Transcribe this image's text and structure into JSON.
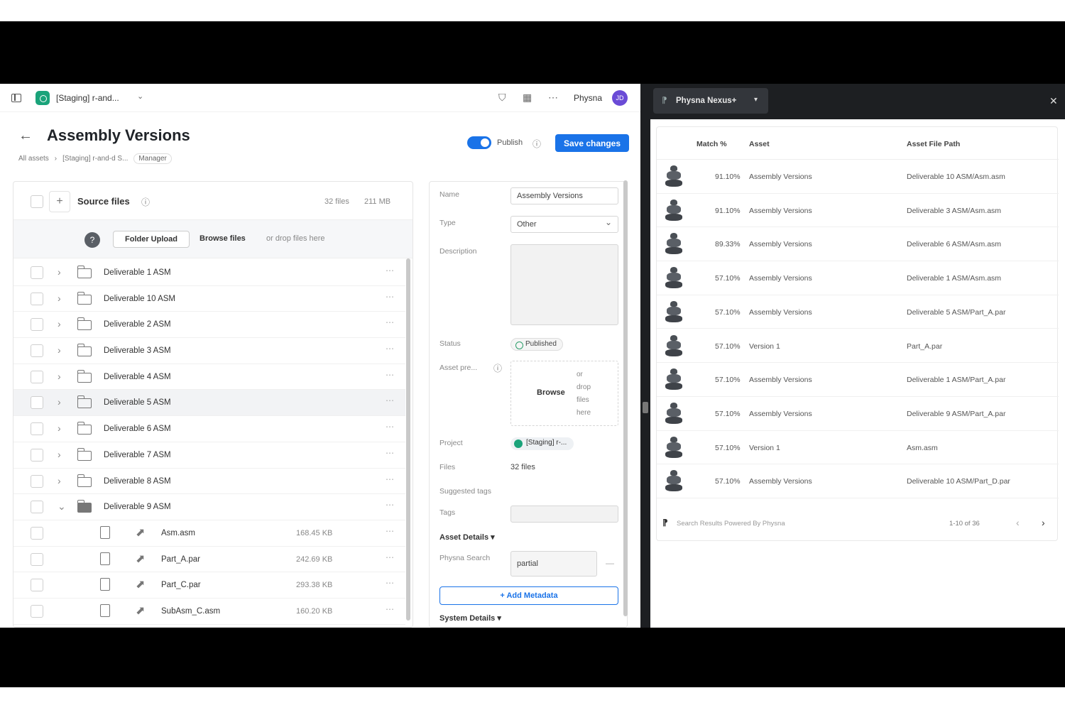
{
  "topbar": {
    "project_name": "[Staging] r-and...",
    "user_name": "Physna",
    "avatar_initials": "JD"
  },
  "page": {
    "title": "Assembly Versions",
    "breadcrumb": [
      "All assets",
      "[Staging] r-and-d S...",
      "Manager"
    ],
    "publish_label": "Publish",
    "save_label": "Save changes"
  },
  "source_files": {
    "label": "Source files",
    "count": "32 files",
    "size": "211 MB",
    "folder_upload": "Folder Upload",
    "browse_files": "Browse files",
    "drop_text": "or drop files here",
    "folders": [
      {
        "name": "Deliverable 1 ASM"
      },
      {
        "name": "Deliverable 10 ASM"
      },
      {
        "name": "Deliverable 2 ASM"
      },
      {
        "name": "Deliverable 3 ASM"
      },
      {
        "name": "Deliverable 4 ASM"
      },
      {
        "name": "Deliverable 5 ASM"
      },
      {
        "name": "Deliverable 6 ASM"
      },
      {
        "name": "Deliverable 7 ASM"
      },
      {
        "name": "Deliverable 8 ASM"
      },
      {
        "name": "Deliverable 9 ASM"
      }
    ],
    "files": [
      {
        "name": "Asm.asm",
        "size": "168.45 KB"
      },
      {
        "name": "Part_A.par",
        "size": "242.69 KB"
      },
      {
        "name": "Part_C.par",
        "size": "293.38 KB"
      },
      {
        "name": "SubAsm_C.asm",
        "size": "160.20 KB"
      }
    ]
  },
  "details": {
    "name_label": "Name",
    "name_value": "Assembly Versions",
    "type_label": "Type",
    "type_value": "Other",
    "description_label": "Description",
    "status_label": "Status",
    "status_value": "Published",
    "preview_label": "Asset pre...",
    "preview_browse": "Browse",
    "preview_drop": "or drop files here",
    "project_label": "Project",
    "project_value": "[Staging] r-...",
    "files_label": "Files",
    "files_value": "32 files",
    "suggested_tags_label": "Suggested tags",
    "tags_label": "Tags",
    "asset_details": "Asset Details",
    "physna_search_label": "Physna Search",
    "physna_search_value": "partial",
    "add_metadata": "+ Add Metadata",
    "system_details": "System Details"
  },
  "extension": {
    "tab_label": "Physna Nexus+",
    "columns": {
      "match": "Match %",
      "asset": "Asset",
      "path": "Asset File Path"
    },
    "results": [
      {
        "match": "91.10%",
        "asset": "Assembly Versions",
        "path": "Deliverable 10 ASM/Asm.asm"
      },
      {
        "match": "91.10%",
        "asset": "Assembly Versions",
        "path": "Deliverable 3 ASM/Asm.asm"
      },
      {
        "match": "89.33%",
        "asset": "Assembly Versions",
        "path": "Deliverable 6 ASM/Asm.asm"
      },
      {
        "match": "57.10%",
        "asset": "Assembly Versions",
        "path": "Deliverable 1 ASM/Asm.asm"
      },
      {
        "match": "57.10%",
        "asset": "Assembly Versions",
        "path": "Deliverable 5 ASM/Part_A.par"
      },
      {
        "match": "57.10%",
        "asset": "Version 1",
        "path": "Part_A.par"
      },
      {
        "match": "57.10%",
        "asset": "Assembly Versions",
        "path": "Deliverable 1 ASM/Part_A.par"
      },
      {
        "match": "57.10%",
        "asset": "Assembly Versions",
        "path": "Deliverable 9 ASM/Part_A.par"
      },
      {
        "match": "57.10%",
        "asset": "Version 1",
        "path": "Asm.asm"
      },
      {
        "match": "57.10%",
        "asset": "Assembly Versions",
        "path": "Deliverable 10 ASM/Part_D.par"
      }
    ],
    "footer": "Search Results Powered By Physna",
    "pager": "1-10 of 36"
  }
}
